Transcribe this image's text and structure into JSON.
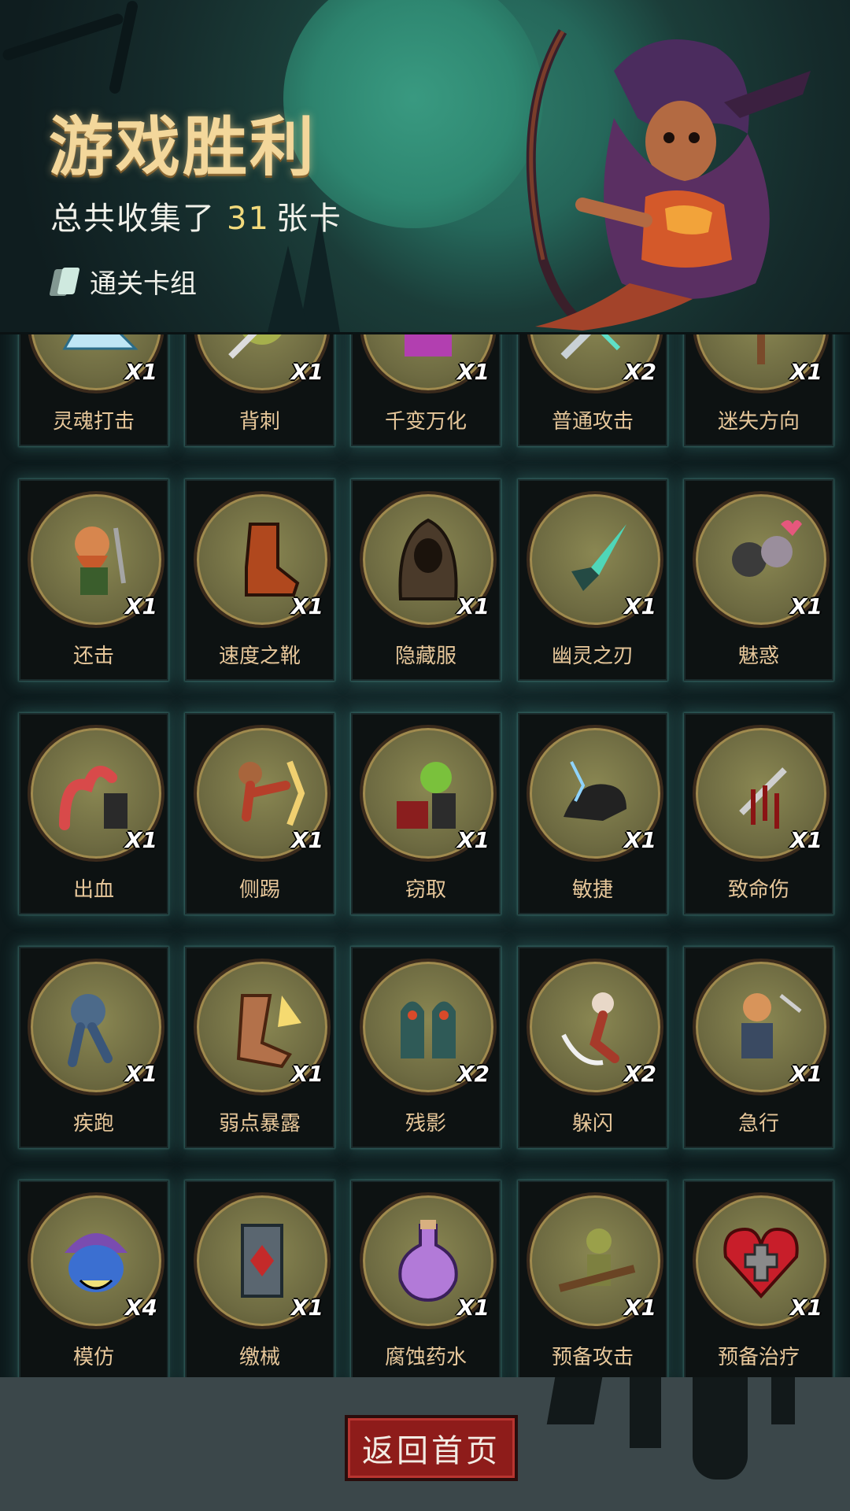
{
  "header": {
    "title": "游戏胜利",
    "collected_prefix": "总共收集了",
    "collected_count": "31",
    "collected_suffix": "张卡",
    "deck_link": "通关卡组"
  },
  "cards": [
    {
      "name": "灵魂打击",
      "count": "X1",
      "icon": "ice-shard-icon"
    },
    {
      "name": "背刺",
      "count": "X1",
      "icon": "backstab-icon"
    },
    {
      "name": "千变万化",
      "count": "X1",
      "icon": "shapeshift-icon"
    },
    {
      "name": "普通攻击",
      "count": "X2",
      "icon": "sword-slash-icon"
    },
    {
      "name": "迷失方向",
      "count": "X1",
      "icon": "signpost-icon"
    },
    {
      "name": "还击",
      "count": "X1",
      "icon": "dwarf-warrior-icon"
    },
    {
      "name": "速度之靴",
      "count": "X1",
      "icon": "boot-icon"
    },
    {
      "name": "隐藏服",
      "count": "X1",
      "icon": "hooded-cloak-icon"
    },
    {
      "name": "幽灵之刃",
      "count": "X1",
      "icon": "ghost-dagger-icon"
    },
    {
      "name": "魅惑",
      "count": "X1",
      "icon": "charm-icon"
    },
    {
      "name": "出血",
      "count": "X1",
      "icon": "tentacle-icon"
    },
    {
      "name": "侧踢",
      "count": "X1",
      "icon": "kick-icon"
    },
    {
      "name": "窃取",
      "count": "X1",
      "icon": "goblin-chest-icon"
    },
    {
      "name": "敏捷",
      "count": "X1",
      "icon": "panther-icon"
    },
    {
      "name": "致命伤",
      "count": "X1",
      "icon": "bleeding-knife-icon"
    },
    {
      "name": "疾跑",
      "count": "X1",
      "icon": "werewolf-icon"
    },
    {
      "name": "弱点暴露",
      "count": "X1",
      "icon": "heel-strike-icon"
    },
    {
      "name": "残影",
      "count": "X2",
      "icon": "shadow-clones-icon"
    },
    {
      "name": "躲闪",
      "count": "X2",
      "icon": "dodge-icon"
    },
    {
      "name": "急行",
      "count": "X1",
      "icon": "rushing-warrior-icon"
    },
    {
      "name": "模仿",
      "count": "X4",
      "icon": "monster-mask-icon"
    },
    {
      "name": "缴械",
      "count": "X1",
      "icon": "disarm-shield-icon"
    },
    {
      "name": "腐蚀药水",
      "count": "X1",
      "icon": "potion-icon"
    },
    {
      "name": "预备攻击",
      "count": "X1",
      "icon": "goblin-spear-icon"
    },
    {
      "name": "预备治疗",
      "count": "X1",
      "icon": "heart-cross-icon"
    }
  ],
  "footer": {
    "home_button": "返回首页"
  },
  "colors": {
    "card_name": "#e7c79a",
    "title": "#f3d79b",
    "count_highlight": "#f2da7c",
    "button": "#8e1c1a",
    "card_glow": "#50aaa0"
  }
}
